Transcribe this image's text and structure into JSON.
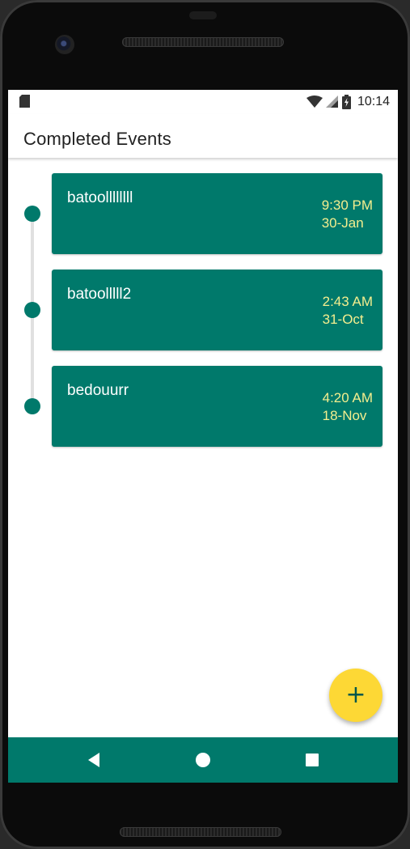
{
  "status_bar": {
    "time": "10:14",
    "icons": [
      "sd-card-icon",
      "wifi-icon",
      "cell-signal-icon",
      "battery-charging-icon"
    ]
  },
  "app_bar": {
    "title": "Completed Events"
  },
  "events": [
    {
      "name": "batoollllllll",
      "time": "9:30 PM",
      "date": "30-Jan"
    },
    {
      "name": "batoolllll2",
      "time": "2:43 AM",
      "date": "31-Oct"
    },
    {
      "name": "bedouurr",
      "time": "4:20 AM",
      "date": "18-Nov"
    }
  ],
  "fab": {
    "label": "+",
    "icon": "add-icon"
  },
  "nav_bar": {
    "icons": [
      "back-icon",
      "home-icon",
      "recents-icon"
    ]
  },
  "colors": {
    "primary": "#00796b",
    "card_time_text": "#f4ee8e",
    "fab": "#fdd835",
    "timeline_line": "#e0e0e0"
  }
}
